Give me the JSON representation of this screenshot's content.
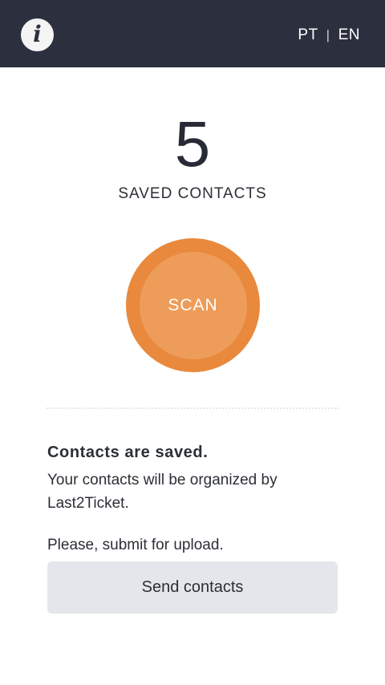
{
  "header": {
    "info_icon": "info-icon",
    "info_glyph": "i",
    "lang_pt": "PT",
    "lang_separator": "|",
    "lang_en": "EN"
  },
  "counter": {
    "value": "5",
    "label": "SAVED CONTACTS"
  },
  "scan": {
    "label": "SCAN"
  },
  "status": {
    "title": "Contacts are saved.",
    "message": "Your contacts will be organized by Last2Ticket.",
    "submit_prompt": "Please, submit for upload."
  },
  "actions": {
    "send_label": "Send contacts"
  },
  "colors": {
    "topbar": "#2c303e",
    "scan_outer": "#e8893d",
    "scan_inner": "#ee9c59",
    "button_bg": "#e3e6ea"
  }
}
